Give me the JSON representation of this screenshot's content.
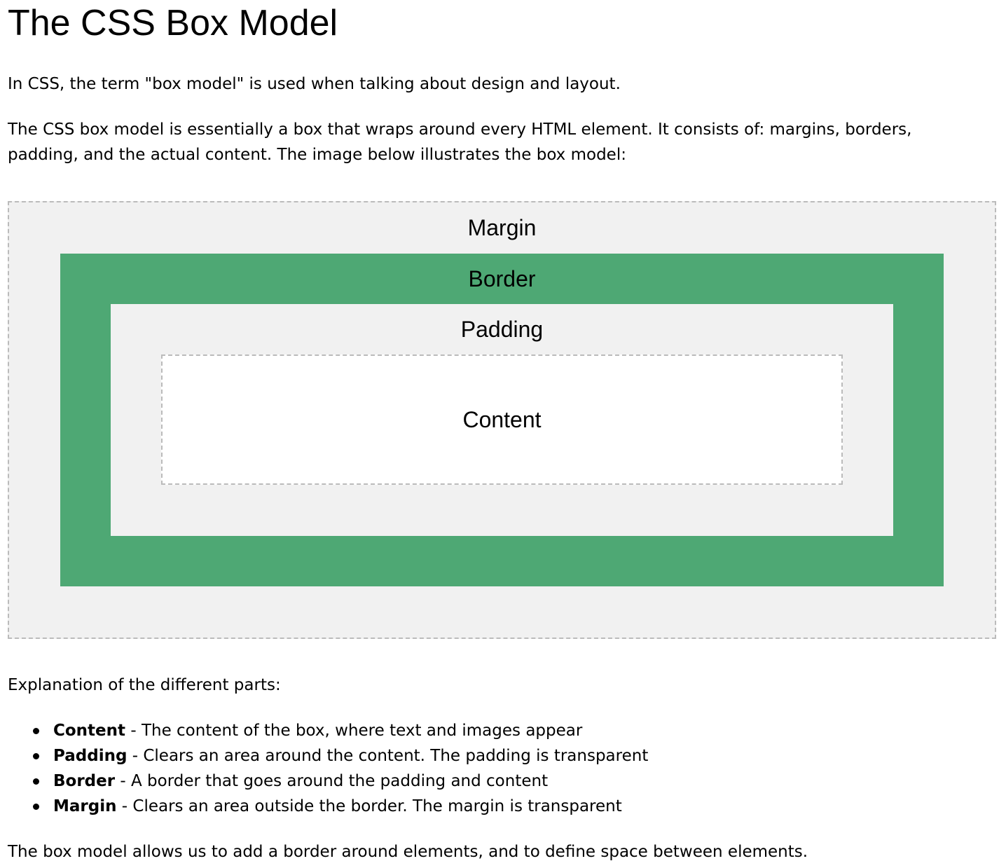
{
  "title": "The CSS Box Model",
  "intro": {
    "p1": "In CSS, the term \"box model\" is used when talking about design and layout.",
    "p2_line1": "The CSS box model is essentially a box that wraps around every HTML element. It consists of: margins, borders,",
    "p2_line2": "padding, and the actual content. The image below illustrates the box model:"
  },
  "diagram": {
    "margin_label": "Margin",
    "border_label": "Border",
    "padding_label": "Padding",
    "content_label": "Content",
    "colors": {
      "margin_bg": "#f1f1f1",
      "border_bg": "#4ea874",
      "padding_bg": "#f1f1f1",
      "content_bg": "#ffffff",
      "dashed_outline": "#bbbbbb"
    }
  },
  "explanation": {
    "heading": "Explanation of the different parts:",
    "items": [
      {
        "term": "Content",
        "description": " - The content of the box, where text and images appear"
      },
      {
        "term": "Padding",
        "description": " - Clears an area around the content. The padding is transparent"
      },
      {
        "term": "Border",
        "description": " - A border that goes around the padding and content"
      },
      {
        "term": "Margin",
        "description": " - Clears an area outside the border. The margin is transparent"
      }
    ]
  },
  "closing": "The box model allows us to add a border around elements, and to define space between elements."
}
